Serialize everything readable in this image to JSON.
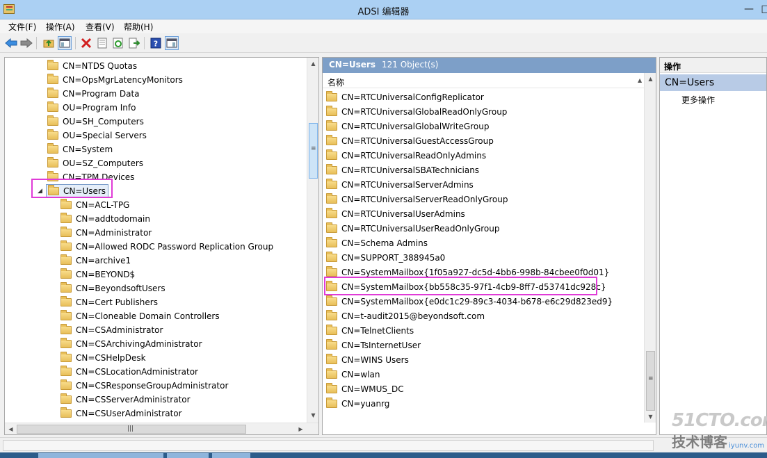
{
  "window": {
    "title": "ADSI 编辑器",
    "minimize": "—",
    "maximize": "□"
  },
  "menu": [
    {
      "label": "文件(F)"
    },
    {
      "label": "操作(A)"
    },
    {
      "label": "查看(V)"
    },
    {
      "label": "帮助(H)"
    }
  ],
  "tree": {
    "items": [
      {
        "label": "CN=NTDS Quotas",
        "level": 0
      },
      {
        "label": "CN=OpsMgrLatencyMonitors",
        "level": 0
      },
      {
        "label": "CN=Program Data",
        "level": 0
      },
      {
        "label": "OU=Program Info",
        "level": 0
      },
      {
        "label": "OU=SH_Computers",
        "level": 0
      },
      {
        "label": "OU=Special Servers",
        "level": 0
      },
      {
        "label": "CN=System",
        "level": 0
      },
      {
        "label": "OU=SZ_Computers",
        "level": 0
      },
      {
        "label": "CN=TPM Devices",
        "level": 0
      },
      {
        "label": "CN=Users",
        "level": 0,
        "expanded": true,
        "selected": true
      },
      {
        "label": "CN=ACL-TPG",
        "level": 1
      },
      {
        "label": "CN=addtodomain",
        "level": 1
      },
      {
        "label": "CN=Administrator",
        "level": 1
      },
      {
        "label": "CN=Allowed RODC Password Replication Group",
        "level": 1
      },
      {
        "label": "CN=archive1",
        "level": 1
      },
      {
        "label": "CN=BEYOND$",
        "level": 1
      },
      {
        "label": "CN=BeyondsoftUsers",
        "level": 1
      },
      {
        "label": "CN=Cert Publishers",
        "level": 1
      },
      {
        "label": "CN=Cloneable Domain Controllers",
        "level": 1
      },
      {
        "label": "CN=CSAdministrator",
        "level": 1
      },
      {
        "label": "CN=CSArchivingAdministrator",
        "level": 1
      },
      {
        "label": "CN=CSHelpDesk",
        "level": 1
      },
      {
        "label": "CN=CSLocationAdministrator",
        "level": 1
      },
      {
        "label": "CN=CSResponseGroupAdministrator",
        "level": 1
      },
      {
        "label": "CN=CSServerAdministrator",
        "level": 1
      },
      {
        "label": "CN=CSUserAdministrator",
        "level": 1
      }
    ]
  },
  "list": {
    "header_title": "CN=Users",
    "header_count": "121 Object(s)",
    "column_name": "名称",
    "items": [
      "CN=RTCUniversalConfigReplicator",
      "CN=RTCUniversalGlobalReadOnlyGroup",
      "CN=RTCUniversalGlobalWriteGroup",
      "CN=RTCUniversalGuestAccessGroup",
      "CN=RTCUniversalReadOnlyAdmins",
      "CN=RTCUniversalSBATechnicians",
      "CN=RTCUniversalServerAdmins",
      "CN=RTCUniversalServerReadOnlyGroup",
      "CN=RTCUniversalUserAdmins",
      "CN=RTCUniversalUserReadOnlyGroup",
      "CN=Schema Admins",
      "CN=SUPPORT_388945a0",
      "CN=SystemMailbox{1f05a927-dc5d-4bb6-998b-84cbee0f0d01}",
      "CN=SystemMailbox{bb558c35-97f1-4cb9-8ff7-d53741dc928c}",
      "CN=SystemMailbox{e0dc1c29-89c3-4034-b678-e6c29d823ed9}",
      "CN=t-audit2015@beyondsoft.com",
      "CN=TelnetClients",
      "CN=TsInternetUser",
      "CN=WINS Users",
      "CN=wlan",
      "CN=WMUS_DC",
      "CN=yuanrg"
    ]
  },
  "actions": {
    "title": "操作",
    "section": "CN=Users",
    "more": "更多操作"
  },
  "watermark": {
    "top": "51CTO.com",
    "bottom": "技术博客",
    "site": "iyunv.com"
  },
  "colors": {
    "highlight": "#e03bd7",
    "header_bg": "#7d9fc8",
    "title_bg": "#abd0f3"
  }
}
